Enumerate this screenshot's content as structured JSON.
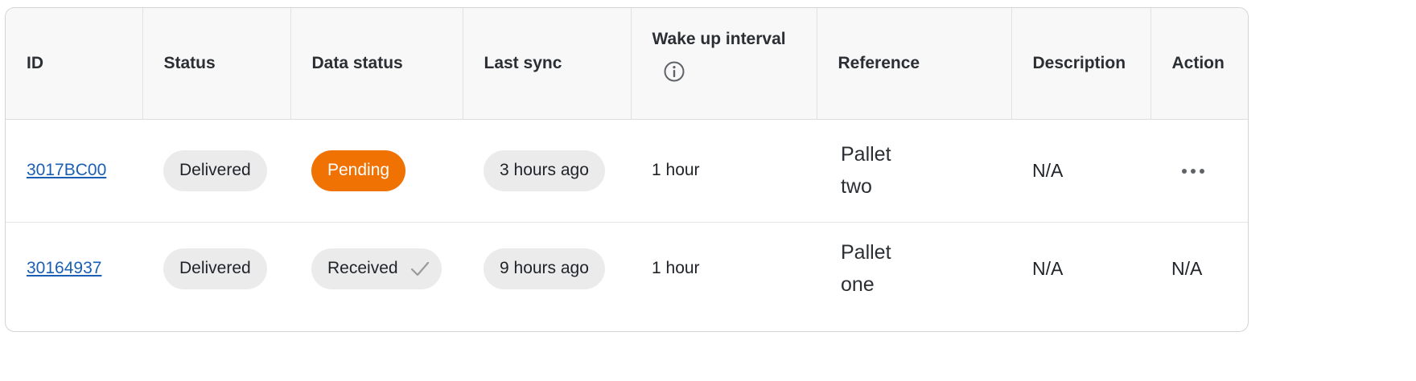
{
  "table": {
    "columns": {
      "id": "ID",
      "status": "Status",
      "data_status": "Data status",
      "last_sync": "Last sync",
      "wake_up_interval": "Wake up interval",
      "reference": "Reference",
      "description": "Description",
      "action": "Action"
    },
    "rows": [
      {
        "id": "3017BC00",
        "status": "Delivered",
        "data_status": "Pending",
        "data_status_color": "#f07203",
        "last_sync": "3 hours ago",
        "wake_up_interval": "1 hour",
        "reference": "Pallet two",
        "description": "N/A",
        "action_icon": "more-horizontal-icon"
      },
      {
        "id": "30164937",
        "status": "Delivered",
        "data_status": "Received",
        "data_status_icon": "check-icon",
        "last_sync": "9 hours ago",
        "wake_up_interval": "1 hour",
        "reference": "Pallet one",
        "description": "N/A",
        "action": "N/A"
      }
    ]
  },
  "colors": {
    "link": "#1a5fb4",
    "pending": "#f07203",
    "pill_bg": "#ebebeb",
    "header_bg": "#f8f8f8"
  }
}
